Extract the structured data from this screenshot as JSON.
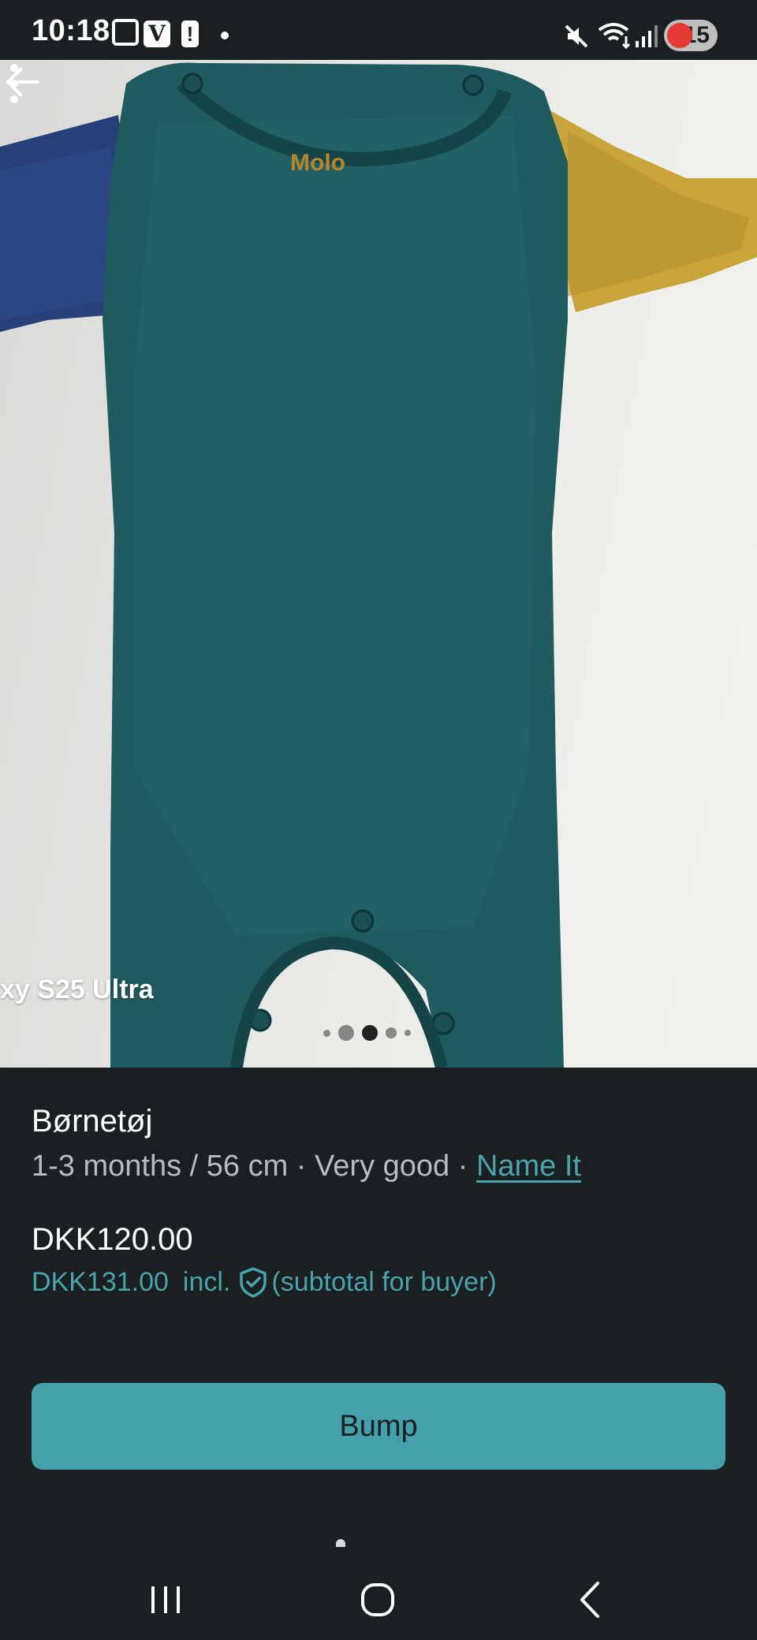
{
  "status_bar": {
    "time": "10:18",
    "battery_level": "15",
    "icons": [
      "screenshot-icon",
      "v-app-icon",
      "alert-icon",
      "dot-icon",
      "mute-icon",
      "wifi-icon",
      "signal-icon",
      "battery-icon"
    ]
  },
  "hero": {
    "watermark": "xy S25 Ultra",
    "image_count": 5,
    "active_image_index": 3,
    "back_icon": "arrow-left-icon",
    "more_icon": "more-vertical-icon"
  },
  "listing": {
    "title": "Børnetøj",
    "size": "1-3 months / 56 cm",
    "separator": " · ",
    "condition": "Very good",
    "brand": "Name It",
    "price": "DKK120.00",
    "buyer_price": "DKK131.00",
    "incl_text": "incl.",
    "buyer_note": "(subtotal for buyer)"
  },
  "actions": {
    "bump_label": "Bump"
  },
  "colors": {
    "background": "#1a1f21",
    "accent": "#44a0aa",
    "link": "#4aa3ac",
    "muted_text": "#b8bcbd"
  },
  "navbar": {
    "icons": [
      "recent-apps-icon",
      "home-icon",
      "back-icon"
    ]
  }
}
